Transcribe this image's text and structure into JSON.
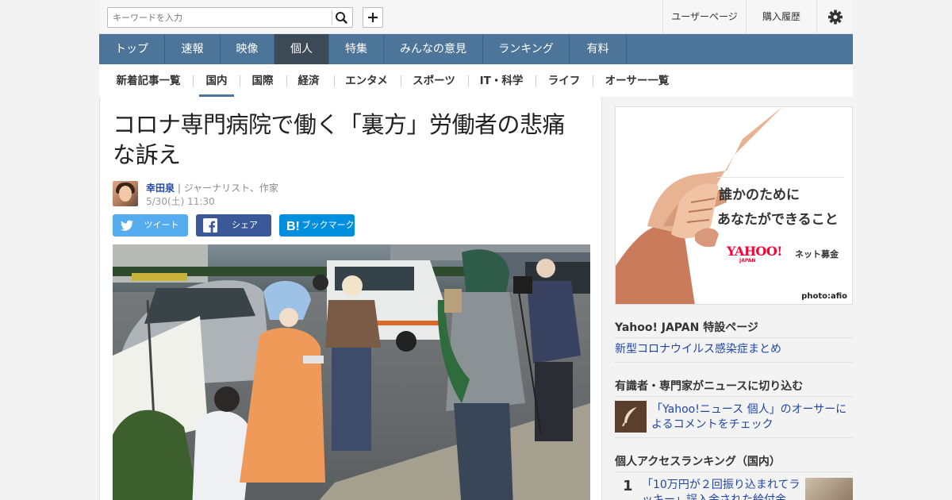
{
  "header": {
    "search_placeholder": "キーワードを入力",
    "user_page": "ユーザーページ",
    "purchase_history": "購入履歴"
  },
  "nav": {
    "items": [
      "トップ",
      "速報",
      "映像",
      "個人",
      "特集",
      "みんなの意見",
      "ランキング",
      "有料"
    ],
    "active": "個人"
  },
  "subnav": {
    "items": [
      "新着記事一覧",
      "国内",
      "国際",
      "経済",
      "エンタメ",
      "スポーツ",
      "IT・科学",
      "ライフ",
      "オーサー一覧"
    ],
    "active": "国内"
  },
  "article": {
    "title_line1": "コロナ専門病院で働く「裏方」労働者の悲痛",
    "title_line2": "な訴え",
    "author_name": "幸田泉",
    "author_role": " | ジャーナリスト、作家",
    "date": "5/30(土) 11:30",
    "share": {
      "tweet": "ツイート",
      "facebook": "シェア",
      "bookmark": "ブックマーク"
    }
  },
  "sidebar": {
    "ad": {
      "line1": "誰かのために",
      "line2": "あなたができること",
      "logo": "YAHOO!",
      "logo_sub": "JAPAN",
      "logo_text": "ネット募金",
      "credit": "photo:afio"
    },
    "special_heading": "Yahoo! JAPAN 特設ページ",
    "special_link": "新型コロナウイルス感染症まとめ",
    "experts_heading": "有識者・専門家がニュースに切り込む",
    "experts_link_line1": "「Yahoo!ニュース 個人」のオーサーに",
    "experts_link_line2": "よるコメントをチェック",
    "ranking_heading": "個人アクセスランキング（国内）",
    "ranking": [
      {
        "rank": "1",
        "line1": "「10万円が２回振り込まれてラ",
        "line2": "ッキー」誤入金された給付金"
      }
    ]
  },
  "colors": {
    "nav": "#4d7599",
    "nav_active": "#3c4a58",
    "link": "#2046a4",
    "twitter": "#55acee",
    "facebook": "#3b5998",
    "hatena": "#008fde"
  }
}
